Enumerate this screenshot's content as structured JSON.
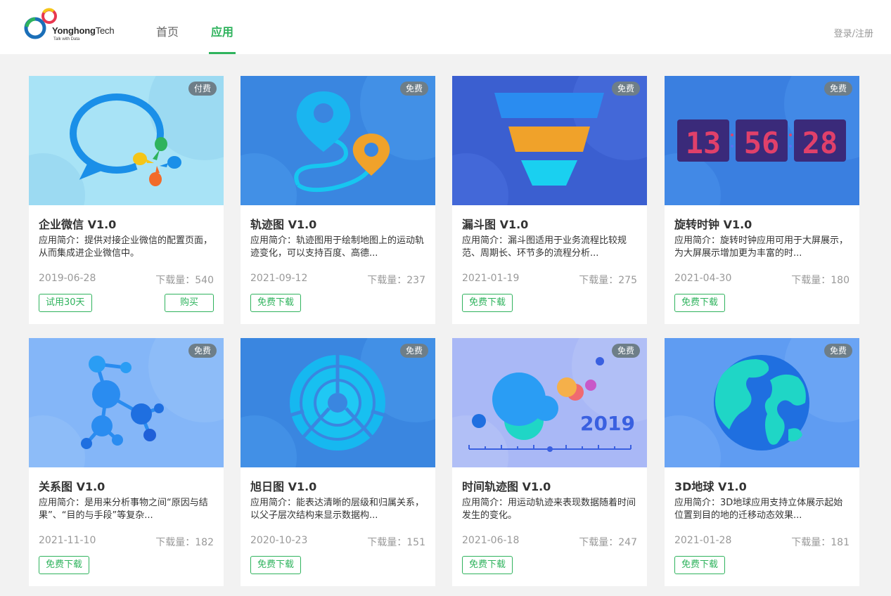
{
  "header": {
    "logo_name_bold": "Yonghong",
    "logo_name_rest": "Tech",
    "logo_tagline": "Talk with Data",
    "nav": [
      {
        "label": "首页",
        "active": false
      },
      {
        "label": "应用",
        "active": true
      }
    ],
    "login_label": "登录/注册",
    "accent_color": "#2fb35d"
  },
  "cards": [
    {
      "title": "企业微信 V1.0",
      "badge": "付费",
      "desc": "应用简介：提供对接企业微信的配置页面，从而集成进企业微信中。",
      "date": "2019-06-28",
      "downloads": "下载量：540",
      "primary_button": "试用30天",
      "secondary_button": "购买",
      "icon": "wechat-work-icon"
    },
    {
      "title": "轨迹图 V1.0",
      "badge": "免费",
      "desc": "应用简介：轨迹图用于绘制地图上的运动轨迹变化，可以支持百度、高德...",
      "date": "2021-09-12",
      "downloads": "下载量：237",
      "primary_button": "免费下载",
      "icon": "map-pin-icon"
    },
    {
      "title": "漏斗图 V1.0",
      "badge": "免费",
      "desc": "应用简介：漏斗图适用于业务流程比较规范、周期长、环节多的流程分析...",
      "date": "2021-01-19",
      "downloads": "下载量：275",
      "primary_button": "免费下载",
      "icon": "funnel-icon"
    },
    {
      "title": "旋转时钟 V1.0",
      "badge": "免费",
      "desc": "应用简介：旋转时钟应用可用于大屏展示，为大屏展示增加更为丰富的时...",
      "date": "2021-04-30",
      "downloads": "下载量：180",
      "primary_button": "免费下载",
      "icon": "digital-clock-icon",
      "clock_digits": [
        "13",
        "56",
        "28"
      ]
    },
    {
      "title": "关系图 V1.0",
      "badge": "免费",
      "desc": "应用简介：是用来分析事物之间“原因与结果”、“目的与手段”等复杂...",
      "date": "2021-11-10",
      "downloads": "下载量：182",
      "primary_button": "免费下载",
      "icon": "network-graph-icon"
    },
    {
      "title": "旭日图 V1.0",
      "badge": "免费",
      "desc": "应用简介：能表达清晰的层级和归属关系，以父子层次结构来显示数据构...",
      "date": "2020-10-23",
      "downloads": "下载量：151",
      "primary_button": "免费下载",
      "icon": "sunburst-icon"
    },
    {
      "title": "时间轨迹图 V1.0",
      "badge": "免费",
      "desc": "应用简介：用运动轨迹来表现数据随着时间发生的变化。",
      "date": "2021-06-18",
      "downloads": "下载量：247",
      "primary_button": "免费下载",
      "icon": "bubble-timeline-icon",
      "year_label": "2019"
    },
    {
      "title": "3D地球 V1.0",
      "badge": "免费",
      "desc": "应用简介：3D地球应用支持立体展示起始位置到目的地的迁移动态效果...",
      "date": "2021-01-28",
      "downloads": "下载量：181",
      "primary_button": "免费下载",
      "icon": "globe-icon"
    }
  ]
}
